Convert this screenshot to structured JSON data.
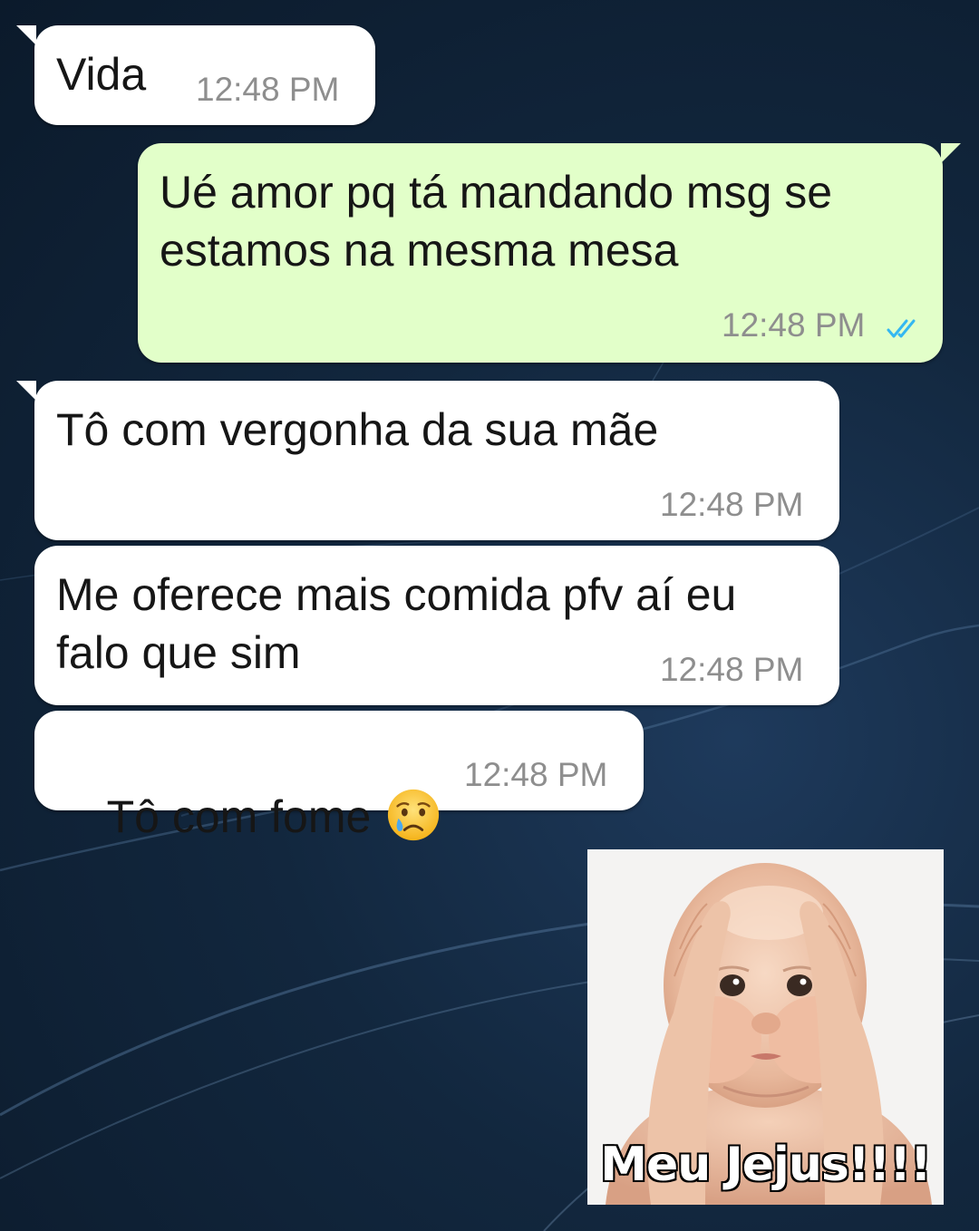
{
  "colors": {
    "incoming_bubble": "#ffffff",
    "outgoing_bubble": "#e2ffc9",
    "timestamp": "#8e8e8e",
    "read_ticks": "#34b7f1"
  },
  "messages": [
    {
      "direction": "incoming",
      "text": "Vida",
      "time": "12:48 PM"
    },
    {
      "direction": "outgoing",
      "text": "Ué amor pq tá mandando msg se estamos na mesma mesa",
      "time": "12:48 PM",
      "status_icon": "double-check-read-icon"
    },
    {
      "direction": "incoming",
      "text": "Tô com vergonha da sua mãe",
      "time": "12:48 PM"
    },
    {
      "direction": "incoming",
      "text": "Me oferece mais comida pfv aí eu falo que sim",
      "time": "12:48 PM"
    },
    {
      "direction": "incoming",
      "text": "Tô com fome",
      "emoji": "crying-face-emoji",
      "time": "12:48 PM"
    }
  ],
  "sticker": {
    "direction": "outgoing",
    "image": "baby-holding-head-sticker",
    "caption": "Meu Jejus!!!!"
  }
}
